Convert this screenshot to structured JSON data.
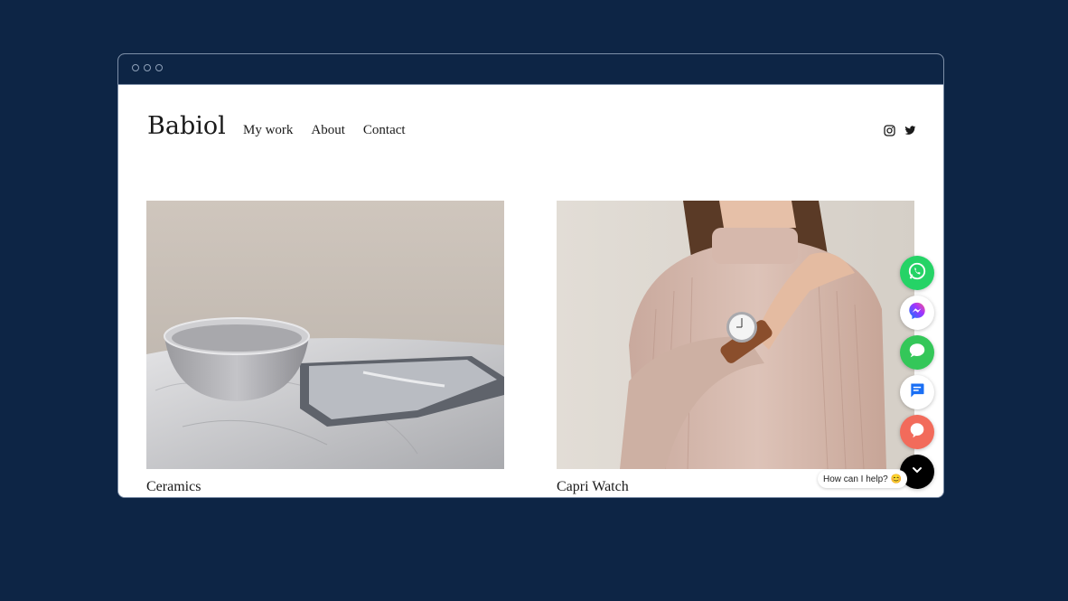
{
  "site": {
    "logo": "Babiol",
    "nav": [
      "My work",
      "About",
      "Contact"
    ],
    "social_icons": [
      "instagram-icon",
      "twitter-icon"
    ]
  },
  "portfolio": [
    {
      "caption": "Ceramics",
      "image": "ceramic bowl and tray on marble table"
    },
    {
      "caption": "Capri Watch",
      "image": "woman in pink turtleneck wearing watch"
    }
  ],
  "chat_widget": {
    "buttons": [
      {
        "name": "whatsapp-icon",
        "color": "#25d366"
      },
      {
        "name": "messenger-icon",
        "color": "#ffffff"
      },
      {
        "name": "imessage-icon",
        "color": "#34c759"
      },
      {
        "name": "sms-icon",
        "color": "#ffffff"
      },
      {
        "name": "livechat-icon",
        "color": "#f26b5b"
      },
      {
        "name": "chevron-down-icon",
        "color": "#000000"
      }
    ],
    "help_text": "How can I help? 😊"
  },
  "colors": {
    "background": "#0d2545",
    "window_border": "#7d8fa8"
  }
}
